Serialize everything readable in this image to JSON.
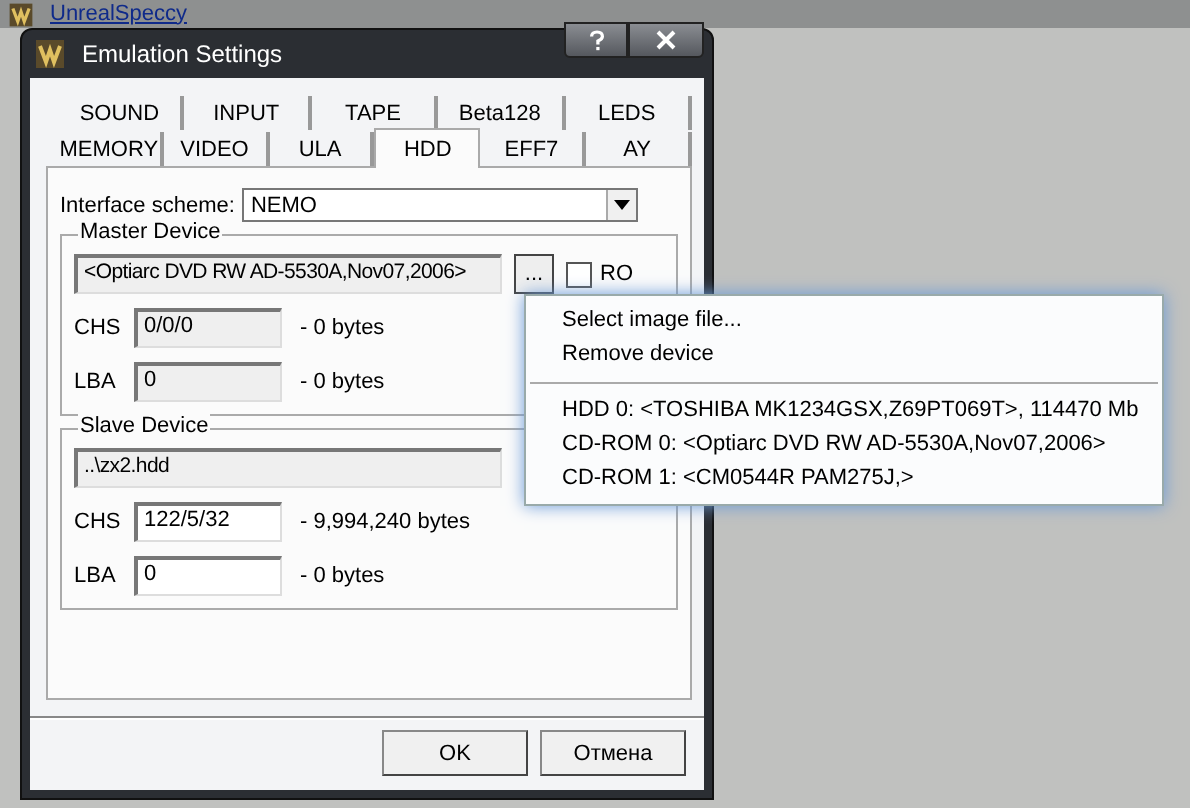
{
  "app": {
    "title": "UnrealSpeccy"
  },
  "window": {
    "title": "Emulation Settings"
  },
  "tab_rows": [
    [
      {
        "label": "SOUND",
        "selected": false
      },
      {
        "label": "INPUT",
        "selected": false
      },
      {
        "label": "TAPE",
        "selected": false
      },
      {
        "label": "Beta128",
        "selected": false
      },
      {
        "label": "LEDS",
        "selected": false
      }
    ],
    [
      {
        "label": "MEMORY",
        "selected": false
      },
      {
        "label": "VIDEO",
        "selected": false
      },
      {
        "label": "ULA",
        "selected": false
      },
      {
        "label": "HDD",
        "selected": true
      },
      {
        "label": "EFF7",
        "selected": false
      },
      {
        "label": "AY",
        "selected": false
      }
    ]
  ],
  "interface_scheme": {
    "label": "Interface scheme:",
    "value": "NEMO"
  },
  "devices": [
    {
      "title": "Master Device",
      "path": "<Optiarc DVD RW AD-5530A,Nov07,2006>",
      "browse": "...",
      "ro": {
        "label": "RO",
        "checked": false
      },
      "rows": [
        {
          "label": "CHS",
          "value": "0/0/0",
          "size": "- 0 bytes",
          "disabled": true
        },
        {
          "label": "LBA",
          "value": "0",
          "size": "- 0 bytes",
          "disabled": true
        }
      ]
    },
    {
      "title": "Slave Device",
      "path": "..\\zx2.hdd",
      "rows": [
        {
          "label": "CHS",
          "value": "122/5/32",
          "size": "- 9,994,240 bytes",
          "disabled": false
        },
        {
          "label": "LBA",
          "value": "0",
          "size": "- 0 bytes",
          "disabled": false
        }
      ]
    }
  ],
  "buttons": [
    "OK",
    "Отмена"
  ],
  "menu": [
    {
      "kind": "item",
      "label": "Select image file..."
    },
    {
      "kind": "item",
      "label": "Remove device"
    },
    {
      "kind": "separator"
    },
    {
      "kind": "item",
      "label": "HDD 0: <TOSHIBA MK1234GSX,Z69PT069T>, 114470 Mb"
    },
    {
      "kind": "item",
      "label": "CD-ROM 0: <Optiarc DVD RW AD-5530A,Nov07,2006>"
    },
    {
      "kind": "item",
      "label": "CD-ROM 1: <CM0544R PAM275J,>"
    }
  ]
}
